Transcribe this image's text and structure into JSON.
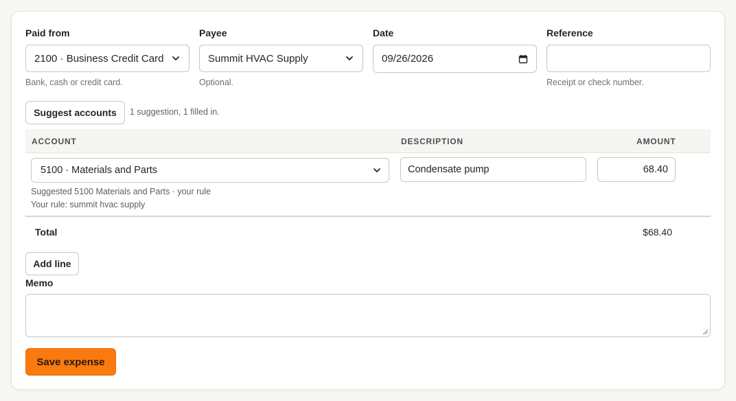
{
  "paid_from": {
    "label": "Paid from",
    "value": "2100 · Business Credit Card",
    "help": "Bank, cash or credit card."
  },
  "payee": {
    "label": "Payee",
    "value": "Summit HVAC Supply",
    "help": "Optional."
  },
  "date": {
    "label": "Date",
    "value": "09/26/2026"
  },
  "reference": {
    "label": "Reference",
    "value": "",
    "help": "Receipt or check number."
  },
  "suggest": {
    "button_label": "Suggest accounts",
    "status": "1 suggestion, 1 filled in."
  },
  "table": {
    "headers": {
      "account": "ACCOUNT",
      "description": "DESCRIPTION",
      "amount": "AMOUNT"
    },
    "lines": [
      {
        "account": "5100 · Materials and Parts",
        "description": "Condensate pump",
        "amount": "68.40",
        "suggestion_note": "Suggested 5100 Materials and Parts · your rule",
        "rule_note": "Your rule: summit hvac supply"
      }
    ],
    "total_label": "Total",
    "total_value": "$68.40"
  },
  "add_line_label": "Add line",
  "memo": {
    "label": "Memo",
    "value": ""
  },
  "save_label": "Save expense",
  "colors": {
    "accent": "#fb7a10",
    "border": "#c9c6c0",
    "help_text": "#6b6f76"
  },
  "icons": {
    "select": "chevron-down-icon",
    "date": "calendar-icon"
  }
}
